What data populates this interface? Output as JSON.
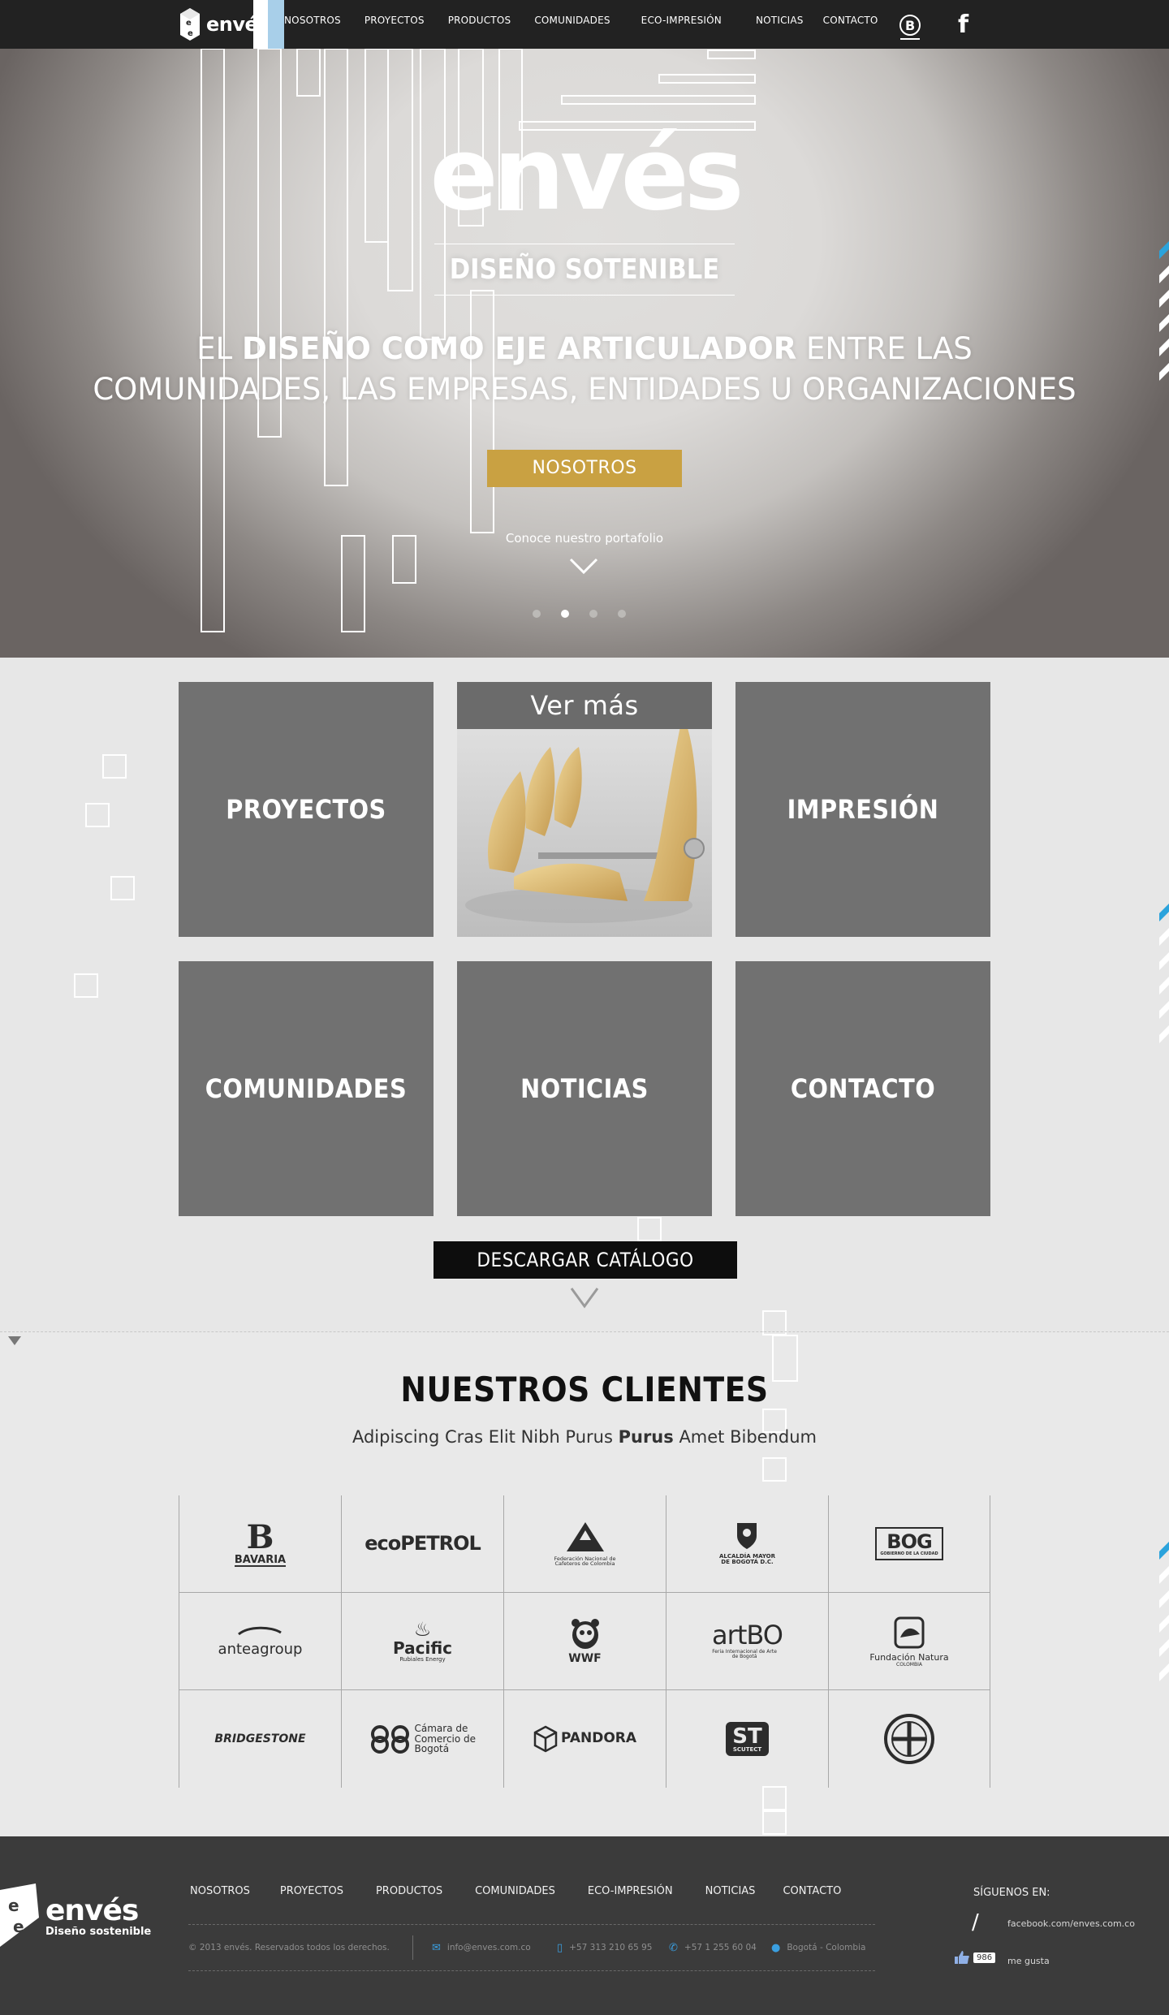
{
  "header": {
    "brand": "envés",
    "nav": [
      "NOSOTROS",
      "PROYECTOS",
      "PRODUCTOS",
      "COMUNIDADES",
      "ECO-IMPRESIÓN",
      "NOTICIAS",
      "CONTACTO"
    ],
    "icons": [
      "bcorp-icon",
      "facebook-icon"
    ]
  },
  "hero": {
    "title": "envés",
    "subtitle": "DISEÑO SOTENIBLE",
    "tagline_pre": "EL ",
    "tagline_bold": "DISEÑO COMO EJE ARTICULADOR",
    "tagline_post": " ENTRE LAS",
    "tagline_line2": "COMUNIDADES, LAS EMPRESAS, ENTIDADES U ORGANIZACIONES",
    "button": "NOSOTROS",
    "portfolio_link": "Conoce nuestro portafolio",
    "slides": 4,
    "active_slide": 2
  },
  "tiles": {
    "items": [
      "PROYECTOS",
      "IMPRESIÓN",
      "COMUNIDADES",
      "NOTICIAS",
      "CONTACTO"
    ],
    "photo_overlay": "Ver más",
    "catalog_button": "DESCARGAR CATÁLOGO"
  },
  "clients": {
    "title": "NUESTROS CLIENTES",
    "subtitle_pre": "Adipiscing Cras Elit Nibh Purus ",
    "subtitle_bold": "Purus",
    "subtitle_post": " Amet Bibendum",
    "logos": [
      {
        "name": "BAVARIA",
        "sub": ""
      },
      {
        "name": "ecoPETROL",
        "sub": ""
      },
      {
        "name": "",
        "sub": "Federación Nacional de Cafeteros de Colombia"
      },
      {
        "name": "ALCALDÍA MAYOR",
        "sub": "DE BOGOTÁ D.C."
      },
      {
        "name": "BOG",
        "sub": "GOBIERNO DE LA CIUDAD"
      },
      {
        "name": "anteagroup",
        "sub": ""
      },
      {
        "name": "Pacific",
        "sub": "Rubiales Energy"
      },
      {
        "name": "WWF",
        "sub": ""
      },
      {
        "name": "artBO",
        "sub": "Feria Internacional de Arte de Bogotá"
      },
      {
        "name": "Fundación Natura",
        "sub": "COLOMBIA"
      },
      {
        "name": "BRIDGESTONE",
        "sub": ""
      },
      {
        "name": "Cámara de Comercio de Bogotá",
        "sub": ""
      },
      {
        "name": "PANDORA",
        "sub": ""
      },
      {
        "name": "ST",
        "sub": "SCUTECT"
      },
      {
        "name": "",
        "sub": ""
      }
    ]
  },
  "footer": {
    "brand": "envés",
    "brand_tag": "Diseño sostenible",
    "nav": [
      "NOSOTROS",
      "PROYECTOS",
      "PRODUCTOS",
      "COMUNIDADES",
      "ECO-IMPRESIÓN",
      "NOTICIAS",
      "CONTACTO"
    ],
    "copyright": "© 2013 envés. Reservados todos los derechos.",
    "email": "info@enves.com.co",
    "mobile": "+57 313 210 65 95",
    "phone": "+57 1 255 60 04",
    "location": "Bogotá - Colombia",
    "follow": "SÍGUENOS EN:",
    "facebook_url": "facebook.com/enves.com.co",
    "likes": "986",
    "likes_label": "me gusta"
  },
  "colors": {
    "topbar": "#222222",
    "accent_gold": "#c9a142",
    "tile_gray": "#717171",
    "footer": "#3b3b3b",
    "link_blue": "#3a9fe0",
    "stripe_blue": "#2ba3dc"
  }
}
